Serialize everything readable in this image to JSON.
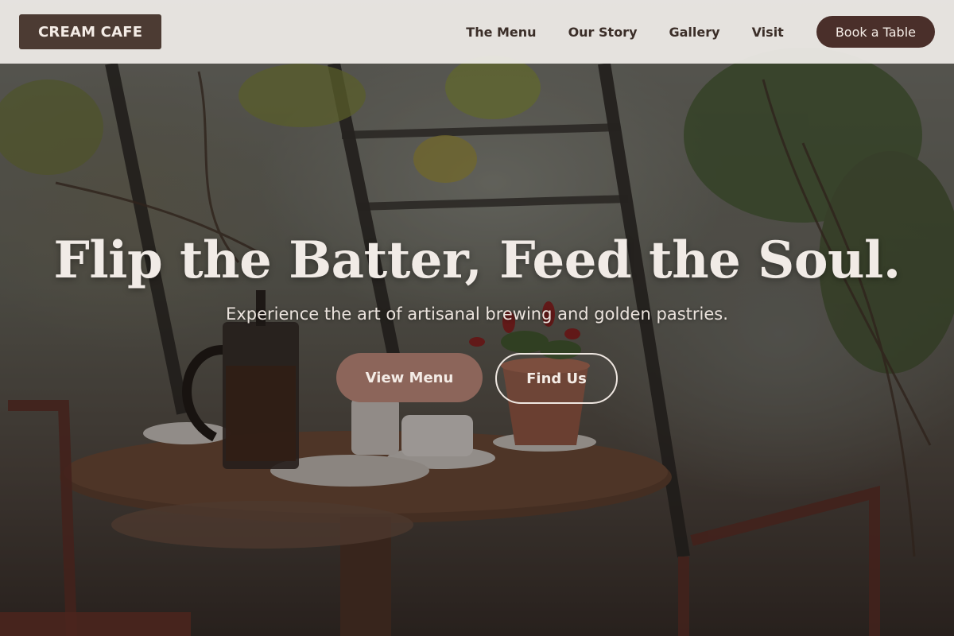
{
  "brand": {
    "name": "CREAM CAFE"
  },
  "nav": {
    "items": [
      {
        "label": "The Menu"
      },
      {
        "label": "Our Story"
      },
      {
        "label": "Gallery"
      },
      {
        "label": "Visit"
      }
    ],
    "cta_label": "Book a Table"
  },
  "hero": {
    "headline": "Flip the Batter, Feed the Soul.",
    "subtitle": "Experience the art of artisanal brewing and golden pastries.",
    "primary_button": "View Menu",
    "secondary_button": "Find Us"
  },
  "colors": {
    "logo_bg": "#4c3b33",
    "book_button_bg": "#4a2f2a",
    "primary_button_bg": "#8c655a",
    "navbar_bg": "#f0ede9",
    "headline_text": "#f1ebe6"
  }
}
